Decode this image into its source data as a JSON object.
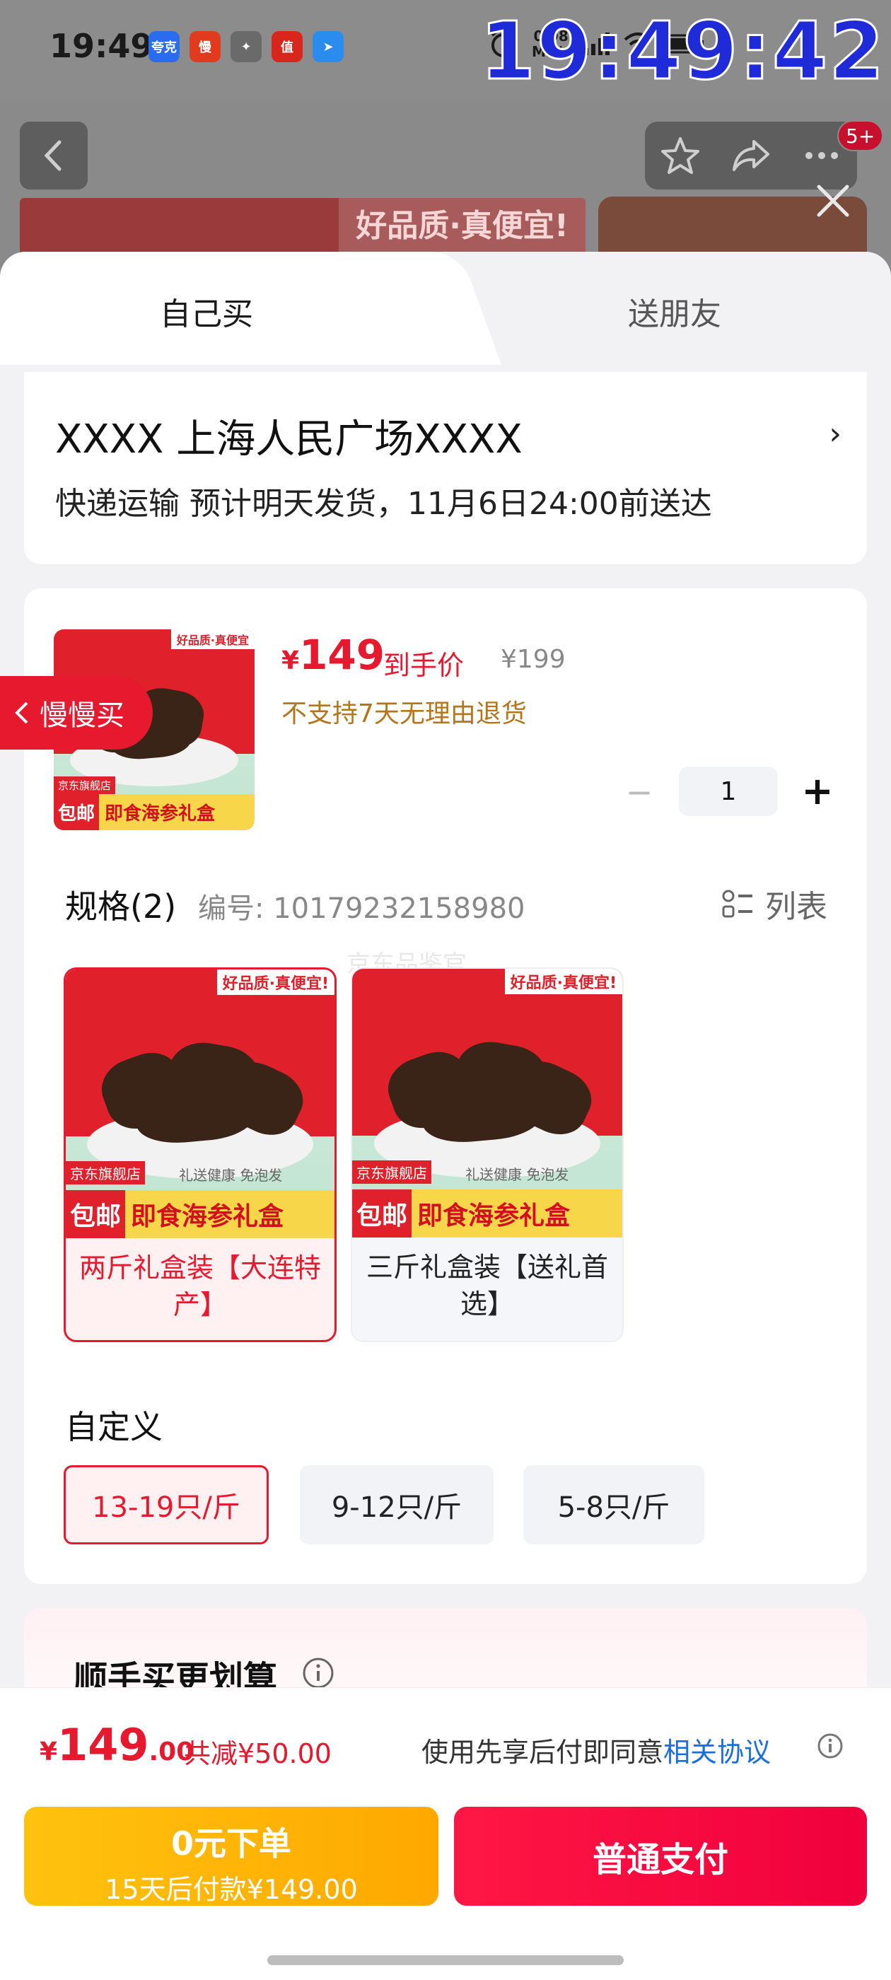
{
  "status_bar": {
    "time": "19:49",
    "net_speed_value": "0.98",
    "net_speed_unit": "MB/s",
    "overlay_clock": "19:49:42",
    "apps": [
      {
        "name": "quark",
        "text": "夸克",
        "color": "#2a6cf0"
      },
      {
        "name": "manman",
        "text": "慢",
        "color": "#e23a1c"
      },
      {
        "name": "handshake",
        "text": "✦",
        "color": "#6a6a6a"
      },
      {
        "name": "zhi",
        "text": "值",
        "color": "#d9261c"
      },
      {
        "name": "send",
        "text": "➤",
        "color": "#2b8cf0"
      }
    ]
  },
  "header": {
    "badge": "5+",
    "banner_tagline": "好品质·真便宜!"
  },
  "tabs": {
    "self_buy": "自己买",
    "gift": "送朋友"
  },
  "address": {
    "title": "XXXX  上海人民广场XXXX",
    "arrow": "›",
    "delivery": "快递运输 预计明天发货，11月6日24:00前送达"
  },
  "product": {
    "price_symbol": "¥",
    "price": "149",
    "price_tag": "到手价",
    "original_price": "¥199",
    "no_return": "不支持7天无理由退货",
    "quantity": "1",
    "minus": "−",
    "plus": "+",
    "thumb": {
      "tagline": "好品质·真便宜",
      "store": "京东旗舰店",
      "free_ship": "包邮",
      "name": "即食海参礼盒"
    }
  },
  "spec": {
    "title": "规格(2)",
    "code": "编号: 10179232158980",
    "list_label": "列表",
    "watermark": "京东品鉴官",
    "options": [
      {
        "label": "两斤礼盒装【大连特产】",
        "selected": true,
        "img_tagline": "好品质·真便宜!",
        "img_store": "京东旗舰店",
        "img_free": "包邮",
        "img_name": "即食海参礼盒",
        "img_gift": "礼送健康  免泡发"
      },
      {
        "label": "三斤礼盒装【送礼首选】",
        "selected": false,
        "img_tagline": "好品质·真便宜!",
        "img_store": "京东旗舰店",
        "img_free": "包邮",
        "img_name": "即食海参礼盒",
        "img_gift": "礼送健康  免泡发"
      }
    ]
  },
  "custom": {
    "title": "自定义",
    "chips": [
      {
        "label": "13-19只/斤",
        "selected": true
      },
      {
        "label": "9-12只/斤",
        "selected": false
      },
      {
        "label": "5-8只/斤",
        "selected": false
      }
    ]
  },
  "extra": {
    "title": "顺手买更划算"
  },
  "float": {
    "label": "慢慢买"
  },
  "bottom": {
    "total_symbol": "¥",
    "total_int": "149",
    "total_dec": ".00",
    "discount": "共减¥50.00",
    "agree_text": "使用先享后付即同意",
    "agree_link": "相关协议",
    "later_line1": "0元下单",
    "later_line2": "15天后付款¥149.00",
    "pay_label": "普通支付"
  },
  "colors": {
    "accent_red": "#e6192e",
    "gold": "#ffb400",
    "link_blue": "#1a6fe0"
  }
}
